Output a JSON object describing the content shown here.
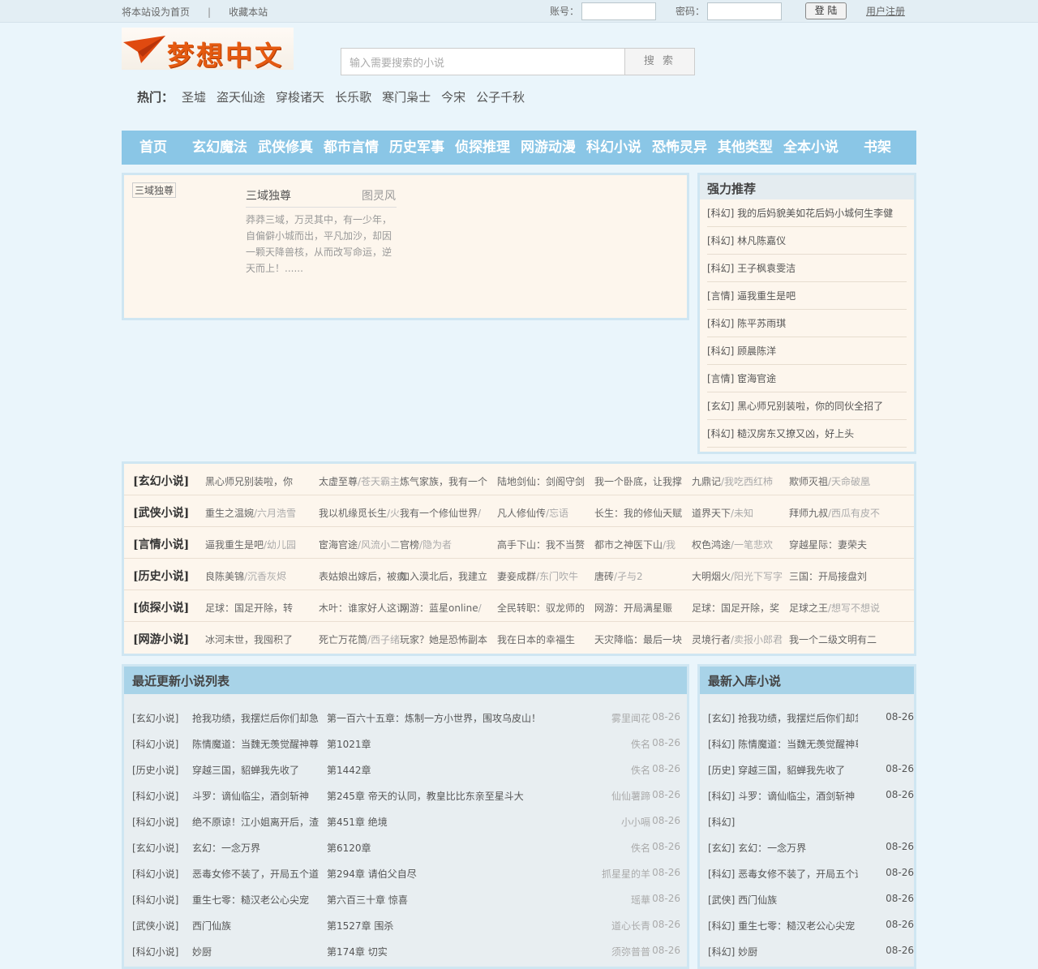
{
  "topbar": {
    "set_home": "将本站设为首页",
    "sep": "|",
    "bookmark": "收藏本站",
    "account_label": "账号：",
    "password_label": "密码：",
    "login": "登 陆",
    "register": "用户注册"
  },
  "logo": {
    "text": "梦想中文"
  },
  "search": {
    "placeholder": "输入需要搜索的小说",
    "button": "搜 索"
  },
  "hot": {
    "label": "热门：",
    "items": [
      "圣墟",
      "盗天仙途",
      "穿梭诸天",
      "长乐歌",
      "寒门枭士",
      "今宋",
      "公子千秋"
    ]
  },
  "nav": [
    "首页",
    "玄幻魔法",
    "武侠修真",
    "都市言情",
    "历史军事",
    "侦探推理",
    "网游动漫",
    "科幻小说",
    "恐怖灵异",
    "其他类型",
    "全本小说",
    "书架"
  ],
  "featured": {
    "tag": "三域独尊",
    "title": "三域独尊",
    "author": "图灵风",
    "desc": "莽莽三域，万灵其中，有一少年，自偏僻小城而出，平凡加沙，却因一颗天降兽核，从而改写命运，逆天而上！......"
  },
  "recommend": {
    "title": "强力推荐",
    "items": [
      "[科幻] 我的后妈貌美如花后妈小城何生李健",
      "[科幻] 林凡陈嘉仪",
      "[科幻] 王子枫袁雯洁",
      "[言情] 逼我重生是吧",
      "[科幻] 陈平苏雨琪",
      "[科幻] 顾晨陈洋",
      "[言情] 宦海官途",
      "[玄幻] 黑心师兄别装啦，你的同伙全招了",
      "[科幻] 糙汉房东又撩又凶，好上头"
    ]
  },
  "categories": [
    {
      "label": "[玄幻小说]",
      "items": [
        {
          "t": "黑心师兄别装啦，你",
          "a": ""
        },
        {
          "t": "太虚至尊",
          "a": "/苍天霸主"
        },
        {
          "t": "炼气家族，我有一个",
          "a": ""
        },
        {
          "t": "陆地剑仙：剑阁守剑",
          "a": ""
        },
        {
          "t": "我一个卧底，让我撑",
          "a": ""
        },
        {
          "t": "九鼎记",
          "a": "/我吃西红柿"
        },
        {
          "t": "欺师灭祖",
          "a": "/天命破凰"
        }
      ]
    },
    {
      "label": "[武侠小说]",
      "items": [
        {
          "t": "重生之温婉",
          "a": "/六月浩雪"
        },
        {
          "t": "我以机缘觅长生",
          "a": "/火"
        },
        {
          "t": "我有一个修仙世界",
          "a": "/"
        },
        {
          "t": "凡人修仙传",
          "a": "/忘语"
        },
        {
          "t": "长生：我的修仙天赋",
          "a": ""
        },
        {
          "t": "道界天下",
          "a": "/未知"
        },
        {
          "t": "拜师九叔",
          "a": "/西瓜有皮不"
        }
      ]
    },
    {
      "label": "[言情小说]",
      "items": [
        {
          "t": "逼我重生是吧",
          "a": "/幼儿园"
        },
        {
          "t": "宦海官途",
          "a": "/风流小二"
        },
        {
          "t": "官榜",
          "a": "/隐为者"
        },
        {
          "t": "高手下山：我不当赘",
          "a": ""
        },
        {
          "t": "都市之神医下山",
          "a": "/我"
        },
        {
          "t": "权色鸿途",
          "a": "/一笔悲欢"
        },
        {
          "t": "穿越星际：妻荣夫",
          "a": ""
        }
      ]
    },
    {
      "label": "[历史小说]",
      "items": [
        {
          "t": "良陈美锦",
          "a": "/沉香灰烬"
        },
        {
          "t": "表姑娘出嫁后，被疯",
          "a": ""
        },
        {
          "t": "加入漠北后，我建立",
          "a": ""
        },
        {
          "t": "妻妾成群",
          "a": "/东门吹牛"
        },
        {
          "t": "唐砖",
          "a": "/孑与2"
        },
        {
          "t": "大明烟火",
          "a": "/阳光下写字"
        },
        {
          "t": "三国：开局接盘刘",
          "a": ""
        }
      ]
    },
    {
      "label": "[侦探小说]",
      "items": [
        {
          "t": "足球：国足开除，转",
          "a": ""
        },
        {
          "t": "木叶：谁家好人这词",
          "a": ""
        },
        {
          "t": "网游：蓝星online",
          "a": "/"
        },
        {
          "t": "全民转职：驭龙师的",
          "a": ""
        },
        {
          "t": "网游：开局满星赈",
          "a": ""
        },
        {
          "t": "足球：国足开除，奖",
          "a": ""
        },
        {
          "t": "足球之王",
          "a": "/想写不想说"
        }
      ]
    },
    {
      "label": "[网游小说]",
      "items": [
        {
          "t": "冰河末世，我囤积了",
          "a": ""
        },
        {
          "t": "死亡万花筒",
          "a": "/西子绪"
        },
        {
          "t": "玩家？她是恐怖副本",
          "a": ""
        },
        {
          "t": "我在日本的幸福生",
          "a": ""
        },
        {
          "t": "天灾降临：最后一块",
          "a": ""
        },
        {
          "t": "灵境行者",
          "a": "/卖报小郎君"
        },
        {
          "t": "我一个二级文明有二",
          "a": ""
        }
      ]
    }
  ],
  "latest": {
    "title": "最近更新小说列表",
    "rows": [
      {
        "cat": "[玄幻小说]",
        "name": "抢我功绩，我摆烂后你们却急",
        "chapter": "第一百六十五章：炼制一方小世界，围攻乌皮山！",
        "author": "雾里闻花",
        "date": "08-26"
      },
      {
        "cat": "[科幻小说]",
        "name": "陈情魔道：当魏无羡觉醒神尊",
        "chapter": "第1021章",
        "author": "佚名",
        "date": "08-26"
      },
      {
        "cat": "[历史小说]",
        "name": "穿越三国，貂蝉我先收了",
        "chapter": "第1442章",
        "author": "佚名",
        "date": "08-26"
      },
      {
        "cat": "[科幻小说]",
        "name": "斗罗：谪仙临尘，酒剑斩神",
        "chapter": "第245章 帝天的认同，教皇比比东亲至星斗大",
        "author": "仙仙薯蹄",
        "date": "08-26"
      },
      {
        "cat": "[科幻小说]",
        "name": "绝不原谅！江小姐离开后，渣",
        "chapter": "第451章 绝境",
        "author": "小小嗝",
        "date": "08-26"
      },
      {
        "cat": "[玄幻小说]",
        "name": "玄幻：一念万界",
        "chapter": "第6120章",
        "author": "佚名",
        "date": "08-26"
      },
      {
        "cat": "[科幻小说]",
        "name": "恶毒女修不装了，开局五个道",
        "chapter": "第294章 请伯父自尽",
        "author": "抓星星的羊",
        "date": "08-26"
      },
      {
        "cat": "[科幻小说]",
        "name": "重生七零：糙汉老公心尖宠",
        "chapter": "第六百三十章 惊喜",
        "author": "瑶華",
        "date": "08-26"
      },
      {
        "cat": "[武侠小说]",
        "name": "西门仙族",
        "chapter": "第1527章 围杀",
        "author": "道心长青",
        "date": "08-26"
      },
      {
        "cat": "[科幻小说]",
        "name": "妙厨",
        "chapter": "第174章 切实",
        "author": "须弥普普",
        "date": "08-26"
      }
    ]
  },
  "newin": {
    "title": "最新入库小说",
    "rows": [
      {
        "t": "[玄幻] 抢我功绩，我摆烂后你们却急了",
        "d": "08-26"
      },
      {
        "t": "[科幻] 陈情魔道：当魏无羡觉醒神尊记忆",
        "d": ""
      },
      {
        "t": "[历史] 穿越三国，貂蝉我先收了",
        "d": "08-26"
      },
      {
        "t": "[科幻] 斗罗：谪仙临尘，酒剑斩神",
        "d": "08-26"
      },
      {
        "t": "[科幻]",
        "d": ""
      },
      {
        "t": "[玄幻] 玄幻：一念万界",
        "d": "08-26"
      },
      {
        "t": "[科幻] 恶毒女修不装了，开局五个道侣",
        "d": "08-26"
      },
      {
        "t": "[武侠] 西门仙族",
        "d": "08-26"
      },
      {
        "t": "[科幻] 重生七零：糙汉老公心尖宠",
        "d": "08-26"
      },
      {
        "t": "[科幻] 妙厨",
        "d": "08-26"
      }
    ]
  }
}
